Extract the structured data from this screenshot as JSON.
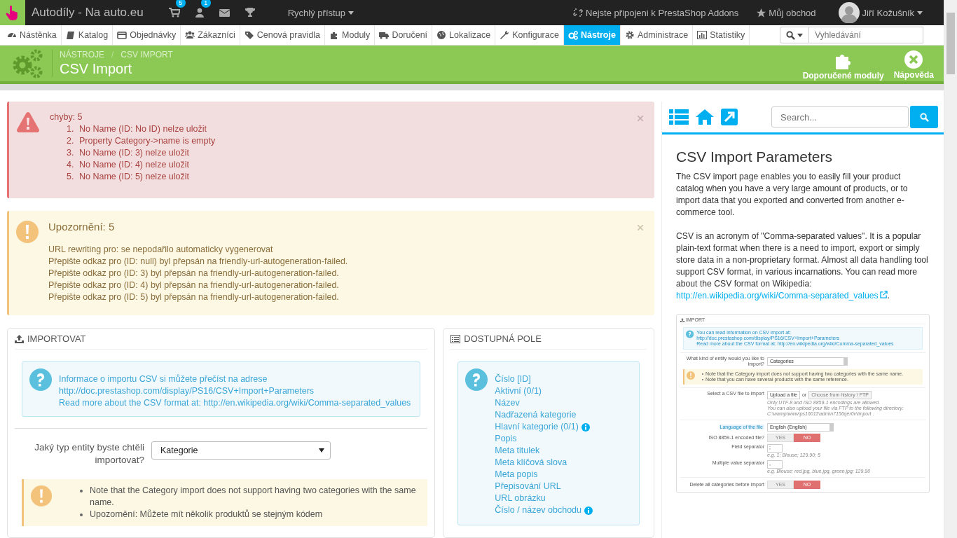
{
  "topbar": {
    "shop_name": "Autodíly - Na auto.eu",
    "orders_badge": "5",
    "customers_badge": "1",
    "quick_access": "Rychlý přístup",
    "addons": "Nejste připojeni k PrestaShop Addons",
    "my_shop": "Můj obchod",
    "user": "Jiří Kožušník"
  },
  "nav": {
    "items": [
      {
        "label": "Nástěnka",
        "selected": false
      },
      {
        "label": "Katalog",
        "selected": false
      },
      {
        "label": "Objednávky",
        "selected": false
      },
      {
        "label": "Zákazníci",
        "selected": false
      },
      {
        "label": "Cenová pravidla",
        "selected": false
      },
      {
        "label": "Moduly",
        "selected": false
      },
      {
        "label": "Doručení",
        "selected": false
      },
      {
        "label": "Lokalizace",
        "selected": false
      },
      {
        "label": "Konfigurace",
        "selected": false
      },
      {
        "label": "Nástroje",
        "selected": true
      },
      {
        "label": "Administrace",
        "selected": false
      },
      {
        "label": "Statistiky",
        "selected": false
      }
    ],
    "search": {
      "placeholder": "Vyhledávání"
    }
  },
  "header": {
    "breadcrumbs": [
      "NÁSTROJE",
      "CSV IMPORT"
    ],
    "breadcrumb_separator": "/",
    "title": "CSV Import",
    "buttons": [
      "Doporučené moduly",
      "Nápověda"
    ]
  },
  "errors": {
    "title": "chyby: 5",
    "items": [
      {
        "number": "1.",
        "text": "No Name (ID: No ID) nelze uložit"
      },
      {
        "number": "2.",
        "text": "Property Category->name is empty"
      },
      {
        "number": "3.",
        "text": "No Name (ID: 3) nelze uložit"
      },
      {
        "number": "4.",
        "text": "No Name (ID: 4) nelze uložit"
      },
      {
        "number": "5.",
        "text": "No Name (ID: 5) nelze uložit"
      }
    ]
  },
  "warnings": {
    "title": "Upozornění: 5",
    "lines": [
      "URL rewriting pro: se nepodařilo automaticky vygenerovat",
      "Přepište odkaz pro (ID: null) byl přepsán na friendly-url-autogeneration-failed.",
      "Přepište odkaz pro (ID: 3) byl přepsán na friendly-url-autogeneration-failed.",
      "Přepište odkaz pro (ID: 4) byl přepsán na friendly-url-autogeneration-failed.",
      "Přepište odkaz pro (ID: 5) byl přepsán na friendly-url-autogeneration-failed."
    ]
  },
  "import_panel": {
    "title": "IMPORTOVAT",
    "info_lines": [
      "Informace o importu CSV si můžete přečíst na adrese",
      "http://doc.prestashop.com/display/PS16/CSV+Import+Parameters",
      "Read more about the CSV format at: http://en.wikipedia.org/wiki/Comma-separated_values"
    ],
    "entity_label": "Jaký typ entity byste chtěli importovat?",
    "entity_value": "Kategorie",
    "notes": [
      "Note that the Category import does not support having two categories with the same name.",
      "Upozornění: Můžete mít několik produktů se stejným kódem"
    ]
  },
  "fields_panel": {
    "title": "DOSTUPNÁ POLE",
    "fields": [
      {
        "label": "Číslo [ID]",
        "info": false
      },
      {
        "label": "Aktivní (0/1)",
        "info": false
      },
      {
        "label": "Název",
        "info": false
      },
      {
        "label": "Nadřazená kategorie",
        "info": false
      },
      {
        "label": "Hlavní kategorie (0/1)",
        "info": true
      },
      {
        "label": "Popis",
        "info": false
      },
      {
        "label": "Meta titulek",
        "info": false
      },
      {
        "label": "Meta klíčová slova",
        "info": false
      },
      {
        "label": "Meta popis",
        "info": false
      },
      {
        "label": "Přepisování URL",
        "info": false
      },
      {
        "label": "URL obrázku",
        "info": false
      },
      {
        "label": "Číslo / název obchodu",
        "info": true
      }
    ]
  },
  "help": {
    "search": {
      "placeholder": "Search..."
    },
    "title": "CSV Import Parameters",
    "paragraph_1": "The CSV import page enables you to easily fill your product catalog when you have a very large amount of products, or to import data that you exported and converted from another e-commerce tool.",
    "paragraph_2": "CSV is an acronym of \"Comma-separated values\". It is a popular plain-text format when there is a need to import, export or simply store data in a non-proprietary format. Almost all data handling tool support CSV format, in various incarnations. You can read more about the CSV format on Wikipedia:",
    "link": "http://en.wikipedia.org/wiki/Comma-separated_values",
    "link_end": ".",
    "screenshot": {
      "title": "IMPORT",
      "info_lines": [
        "You can read information on CSV import at: http://doc.prestashop.com/display/PS16/CSV+Import+Parameters",
        "Read more about the CSV format at: http://en.wikipedia.org/wiki/Comma-separated_values"
      ],
      "entity_label": "What kind of entity would you like to import?",
      "entity_value": "Categories",
      "notes": [
        "Note that the Category import does not support having two categories with the same name.",
        "Note that you can have several products with the same reference."
      ],
      "file_label": "Select a CSV file to import",
      "upload": "Upload a file",
      "or": "or",
      "history": "Choose from history / FTP",
      "file_hints": [
        "Only UTF-8 and ISO 8859-1 encodings are allowed.",
        "You can also upload your file via FTP to the following directory:",
        "C:\\wamp\\www\\ps16011\\admin7156qer0v\\import ."
      ],
      "language_label": "Language of the file",
      "language_value": "English (English)",
      "iso_label": "ISO 8859-1 encoded file?",
      "iso_options": [
        {
          "label": "YES",
          "selected": false
        },
        {
          "label": "NO",
          "selected": true
        }
      ],
      "field_sep_label": "Field separator",
      "field_sep_value": ";",
      "field_sep_hint": "e.g. 1; Blouse; 129.90; 5",
      "multi_sep_label": "Multiple value separator",
      "multi_sep_value": ",",
      "multi_sep_hint": "e.g. Blouse; red.jpg, blue.jpg, green.jpg; 129.90",
      "delete_label": "Delete all categories before import",
      "delete_options": [
        {
          "label": "YES",
          "selected": false
        },
        {
          "label": "NO",
          "selected": true
        }
      ]
    }
  }
}
